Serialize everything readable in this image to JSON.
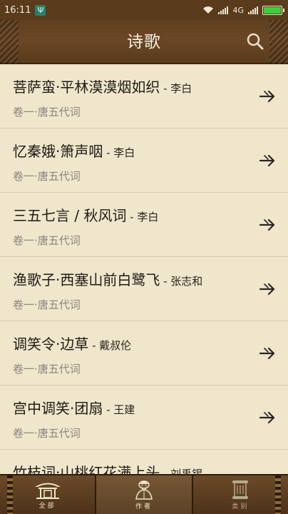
{
  "status_bar": {
    "time": "16:11",
    "network": "4G",
    "usb_glyph": "Ψ",
    "battery_level": 1.0
  },
  "header": {
    "title": "诗歌",
    "search_icon": "search-icon"
  },
  "list": {
    "items": [
      {
        "title": "菩萨蛮·平林漠漠烟如织",
        "author": " - 李白",
        "subtitle": "卷一·唐五代词"
      },
      {
        "title": "忆秦娥·箫声咽",
        "author": " - 李白",
        "subtitle": "卷一·唐五代词"
      },
      {
        "title": "三五七言 / 秋风词",
        "author": " - 李白",
        "subtitle": "卷一·唐五代词"
      },
      {
        "title": "渔歌子·西塞山前白鹭飞",
        "author": " - 张志和",
        "subtitle": "卷一·唐五代词"
      },
      {
        "title": "调笑令·边草",
        "author": " - 戴叔伦",
        "subtitle": "卷一·唐五代词"
      },
      {
        "title": "宫中调笑·团扇",
        "author": " - 王建",
        "subtitle": "卷一·唐五代词"
      },
      {
        "title": "竹枝词·山桃红花满上头",
        "author": " - 刘禹锡",
        "subtitle": ""
      }
    ]
  },
  "bottom_nav": {
    "items": [
      {
        "label": "全部",
        "icon": "pavilion-icon"
      },
      {
        "label": "作者",
        "icon": "scholar-icon"
      },
      {
        "label": "类别",
        "icon": "scroll-icon"
      }
    ],
    "active_index": 1
  },
  "colors": {
    "accent_brown": "#5a3b1c",
    "paper": "#efe6cc"
  }
}
